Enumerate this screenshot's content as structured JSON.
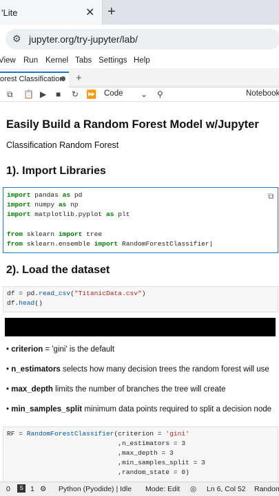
{
  "browser": {
    "tab_title": "'Lite",
    "close": "✕",
    "new_tab": "+",
    "url": "jupyter.org/try-jupyter/lab/"
  },
  "menu": [
    "View",
    "Run",
    "Kernel",
    "Tabs",
    "Settings",
    "Help"
  ],
  "notebook_tab": {
    "title": "orest Classification",
    "add": "+"
  },
  "toolbar": {
    "cell_type": "Code",
    "kernel_label": "Notebook"
  },
  "content": {
    "title": "Easily Build a Random Forest Model w/Jupyter",
    "subtitle": "Classification Random Forest",
    "section1": "1). Import Libraries",
    "section2": "2). Load the dataset",
    "bullets": [
      {
        "term": "criterion",
        "text": " = 'gini' is the default"
      },
      {
        "term": "n_estimators",
        "text": " selects how many decision trees the random forest will use"
      },
      {
        "term": "max_depth",
        "text": " limits the number of branches the tree will create"
      },
      {
        "term": "min_samples_split",
        "text": " minimum data points required to split a decision node"
      }
    ]
  },
  "cells": {
    "imports": [
      "import pandas as pd",
      "import numpy as np",
      "import matplotlib.pyplot as plt",
      "",
      "from sklearn import tree",
      "from sklearn.ensemble import RandomForestClassifier"
    ],
    "load": [
      "df = pd.read_csv(\"TitanicData.csv\")",
      "df.head()"
    ],
    "model": [
      "RF = RandomForestClassifier(criterion = 'gini'",
      "                            ,n_estimators = 3",
      "                            ,max_depth = 3",
      "                            ,min_samples_split = 3",
      "                            ,random_state = 0)"
    ]
  },
  "status": {
    "count_a": "0",
    "count_b": "1",
    "kernel": "Python (Pyodide) | Idle",
    "mode": "Mode: Edit",
    "position": "Ln 6, Col 52",
    "file": "Random"
  }
}
